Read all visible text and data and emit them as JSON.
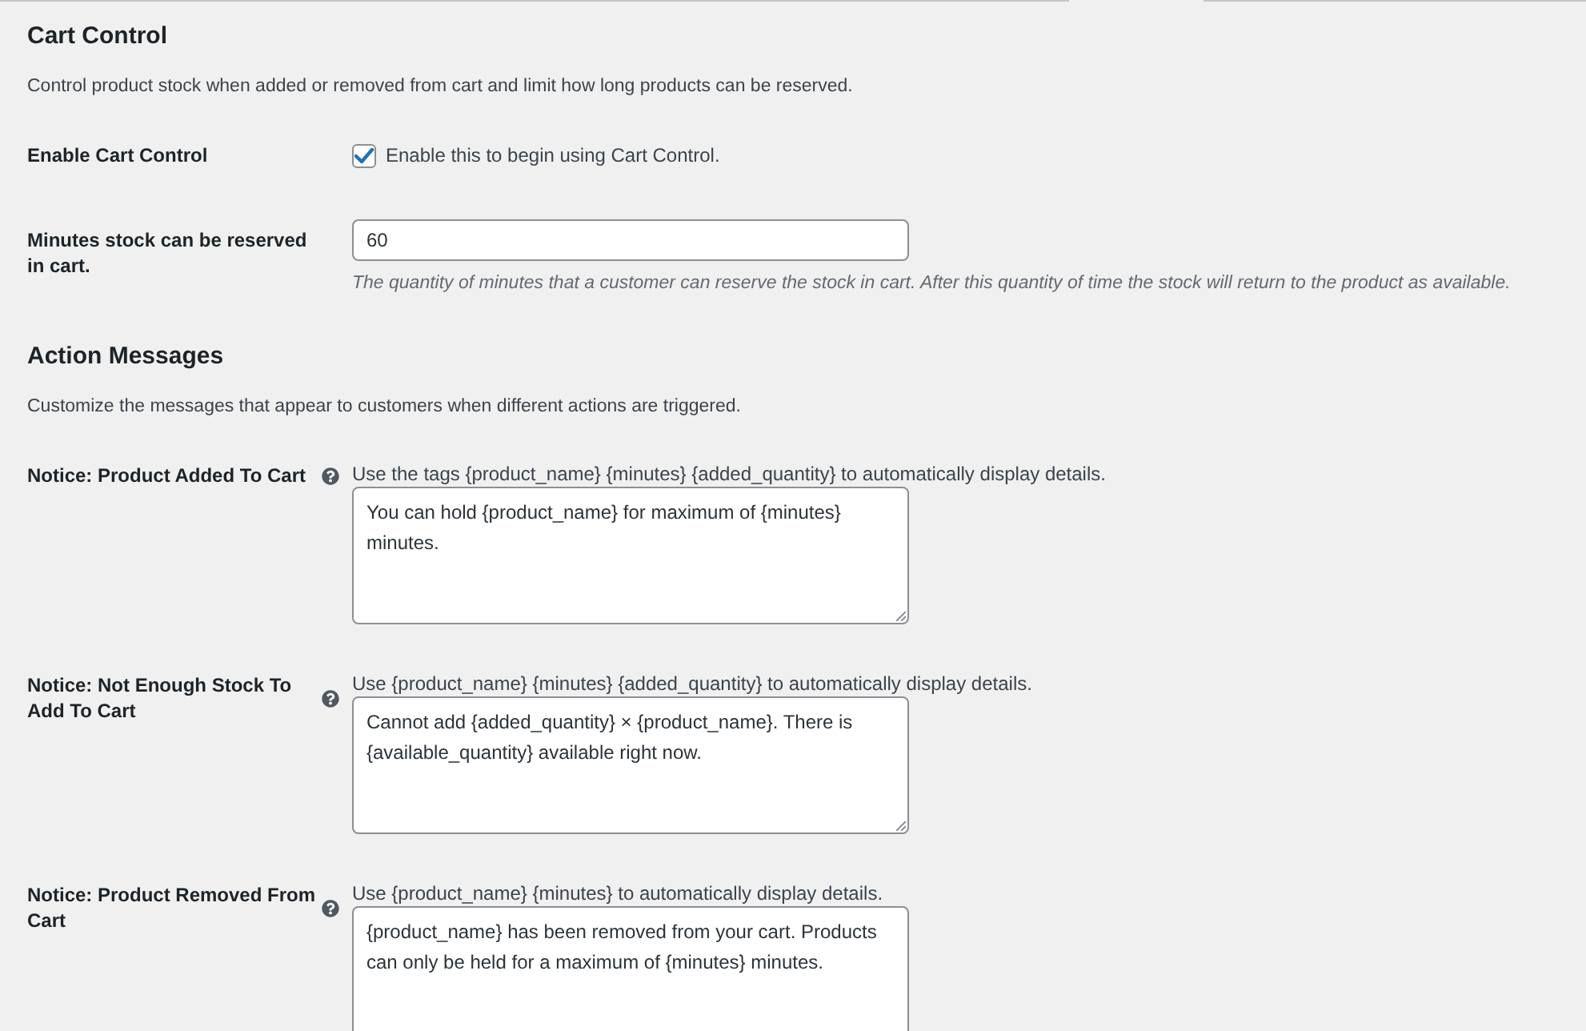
{
  "sections": [
    {
      "title": "Cart Control",
      "description": "Control product stock when added or removed from cart and limit how long products can be reserved.",
      "fields": [
        {
          "kind": "checkbox",
          "label": "Enable Cart Control",
          "checked": true,
          "text": "Enable this to begin using Cart Control."
        },
        {
          "kind": "number",
          "label": "Minutes stock can be reserved in cart.",
          "value": "60",
          "help_text": "The quantity of minutes that a customer can reserve the stock in cart. After this quantity of time the stock will return to the product as available."
        }
      ]
    },
    {
      "title": "Action Messages",
      "description": "Customize the messages that appear to customers when different actions are triggered.",
      "fields": [
        {
          "kind": "textarea",
          "label": "Notice: Product Added To Cart",
          "hint": "Use the tags {product_name} {minutes} {added_quantity} to automatically display details.",
          "value": "You can hold {product_name} for maximum of {minutes} minutes."
        },
        {
          "kind": "textarea",
          "label": "Notice: Not Enough Stock To Add To Cart",
          "hint": "Use {product_name} {minutes} {added_quantity} to automatically display details.",
          "value": "Cannot add {added_quantity} × {product_name}. There is {available_quantity} available right now."
        },
        {
          "kind": "textarea",
          "label": "Notice: Product Removed From Cart",
          "hint": "Use {product_name} {minutes} to automatically display details.",
          "value": "{product_name} has been removed from your cart. Products can only be held for a maximum of {minutes} minutes."
        }
      ]
    }
  ]
}
